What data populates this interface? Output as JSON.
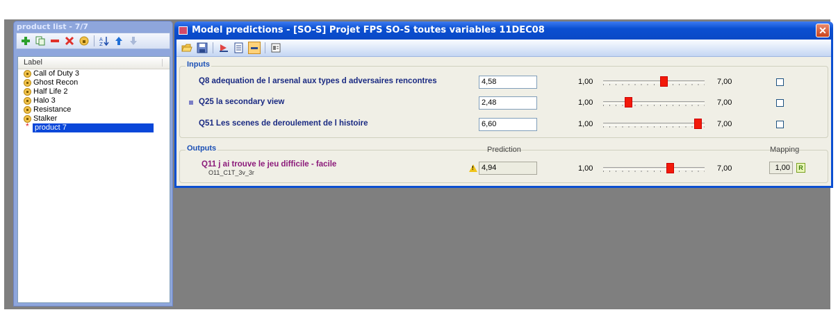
{
  "product_list": {
    "title": "product list - 7/7",
    "column_header": "Label",
    "items": [
      {
        "label": "Call of Duty 3",
        "icon": "lock-icon"
      },
      {
        "label": "Ghost Recon",
        "icon": "lock-icon"
      },
      {
        "label": "Half Life 2",
        "icon": "lock-icon"
      },
      {
        "label": "Halo 3",
        "icon": "lock-icon"
      },
      {
        "label": "Resistance",
        "icon": "lock-icon"
      },
      {
        "label": "Stalker",
        "icon": "lock-icon"
      },
      {
        "label": "product 7",
        "icon": "new-item-marker",
        "selected": true
      }
    ],
    "toolbar_icons": [
      "add-icon",
      "copy-icon",
      "remove-icon",
      "delete-icon",
      "lock-icon",
      "sort-icon",
      "move-up-icon",
      "move-down-icon"
    ]
  },
  "model_window": {
    "title": "Model predictions - [SO-S] Projet FPS SO-S toutes variables 11DEC08",
    "close_symbol": "✕",
    "toolbar_icons": [
      "open-icon",
      "save-icon",
      "run-icon",
      "sheet-icon",
      "highlight-icon",
      "export-icon"
    ],
    "inputs": {
      "title": "Inputs",
      "rows": [
        {
          "label": "Q8 adequation de l arsenal aux types d adversaires rencontres",
          "value": "4,58",
          "min": "1,00",
          "max": "7,00",
          "level": 4.58,
          "checked": false,
          "marker": false
        },
        {
          "label": "Q25 la secondary view",
          "value": "2,48",
          "min": "1,00",
          "max": "7,00",
          "level": 2.48,
          "checked": false,
          "marker": true
        },
        {
          "label": "Q51 Les scenes de deroulement de l histoire",
          "value": "6,60",
          "min": "1,00",
          "max": "7,00",
          "level": 6.6,
          "checked": false,
          "marker": false
        }
      ]
    },
    "outputs": {
      "title": "Outputs",
      "prediction_header": "Prediction",
      "mapping_header": "Mapping",
      "rows": [
        {
          "label": "Q11 j ai trouve le jeu difficile - facile",
          "sub": "O11_C1T_3v_3r",
          "value": "4,94",
          "min": "1,00",
          "max": "7,00",
          "level": 4.94,
          "mapping": "1,00",
          "mapping_icon": "R"
        }
      ]
    }
  }
}
